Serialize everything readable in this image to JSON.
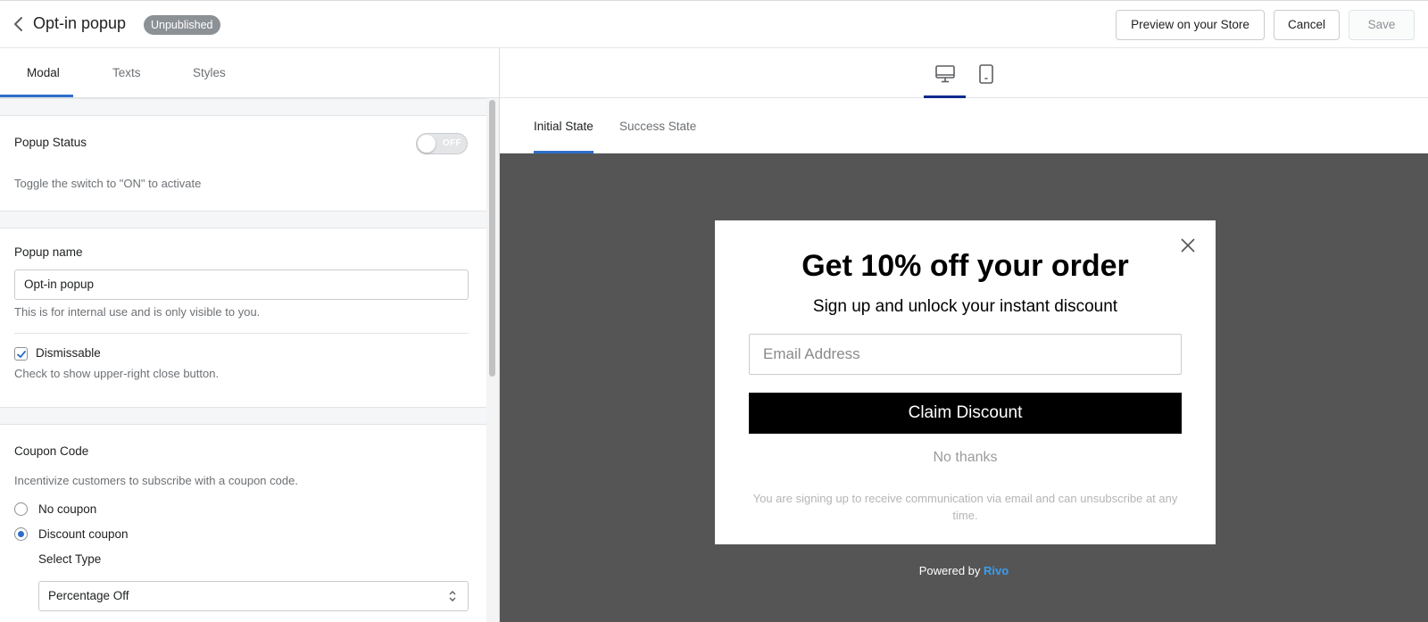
{
  "header": {
    "back_icon": "chevron-left-icon",
    "title": "Opt-in popup",
    "badge": "Unpublished",
    "preview_label": "Preview on your Store",
    "cancel_label": "Cancel",
    "save_label": "Save"
  },
  "left_tabs": [
    {
      "label": "Modal",
      "active": true
    },
    {
      "label": "Texts",
      "active": false
    },
    {
      "label": "Styles",
      "active": false
    }
  ],
  "popup_status": {
    "label": "Popup Status",
    "toggle_state": "OFF",
    "help": "Toggle the switch to \"ON\" to activate"
  },
  "popup_name": {
    "label": "Popup name",
    "value": "Opt-in popup",
    "help": "This is for internal use and is only visible to you."
  },
  "dismissable": {
    "label": "Dismissable",
    "checked": true,
    "help": "Check to show upper-right close button."
  },
  "coupon": {
    "label": "Coupon Code",
    "help": "Incentivize customers to subscribe with a coupon code.",
    "options": [
      {
        "label": "No coupon",
        "selected": false
      },
      {
        "label": "Discount coupon",
        "selected": true
      }
    ],
    "select_type_label": "Select Type",
    "select_type_value": "Percentage Off"
  },
  "device_toggle": {
    "desktop_icon": "desktop-icon",
    "mobile_icon": "mobile-icon",
    "active": "desktop"
  },
  "state_tabs": [
    {
      "label": "Initial State",
      "active": true
    },
    {
      "label": "Success State",
      "active": false
    }
  ],
  "preview": {
    "heading": "Get 10% off your order",
    "subheading": "Sign up and unlock your instant discount",
    "email_placeholder": "Email Address",
    "claim_label": "Claim Discount",
    "no_thanks": "No thanks",
    "disclaimer": "You are signing up to receive communication via email and can unsubscribe at any time.",
    "powered_by": "Powered by",
    "brand": "Rivo"
  },
  "colors": {
    "accent": "#2c6ecb",
    "canvas_bg": "#555555",
    "claim_bg": "#000000",
    "brand_link": "#3b9cf0"
  }
}
